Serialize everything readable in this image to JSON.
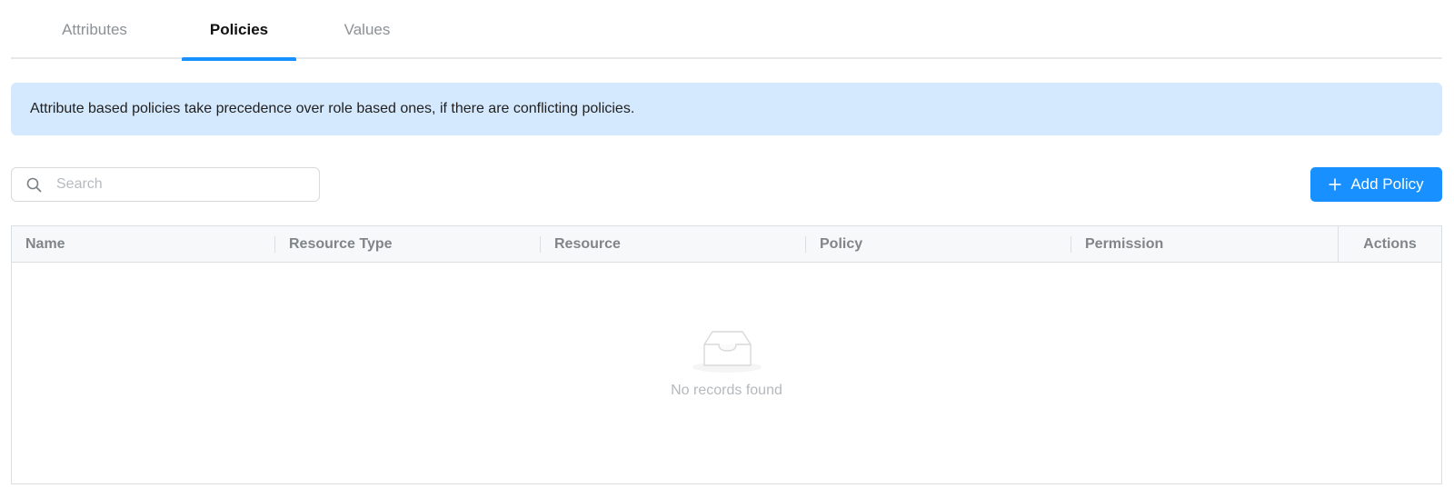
{
  "tabs": [
    {
      "label": "Attributes",
      "active": false
    },
    {
      "label": "Policies",
      "active": true
    },
    {
      "label": "Values",
      "active": false
    }
  ],
  "banner": {
    "text": "Attribute based policies take precedence over role based ones, if there are conflicting policies."
  },
  "search": {
    "placeholder": "Search",
    "value": "",
    "icon": "search-icon"
  },
  "toolbar": {
    "add_label": "Add Policy",
    "add_icon": "plus-icon"
  },
  "table": {
    "columns": [
      "Name",
      "Resource Type",
      "Resource",
      "Policy",
      "Permission",
      "Actions"
    ],
    "rows": [],
    "empty_text": "No records found",
    "empty_icon": "empty-inbox-icon"
  },
  "colors": {
    "accent": "#1890ff",
    "banner_bg": "#d5e9fe",
    "header_bg": "#f7f8fa",
    "border": "#dcdfe2",
    "muted_text": "#808589"
  }
}
